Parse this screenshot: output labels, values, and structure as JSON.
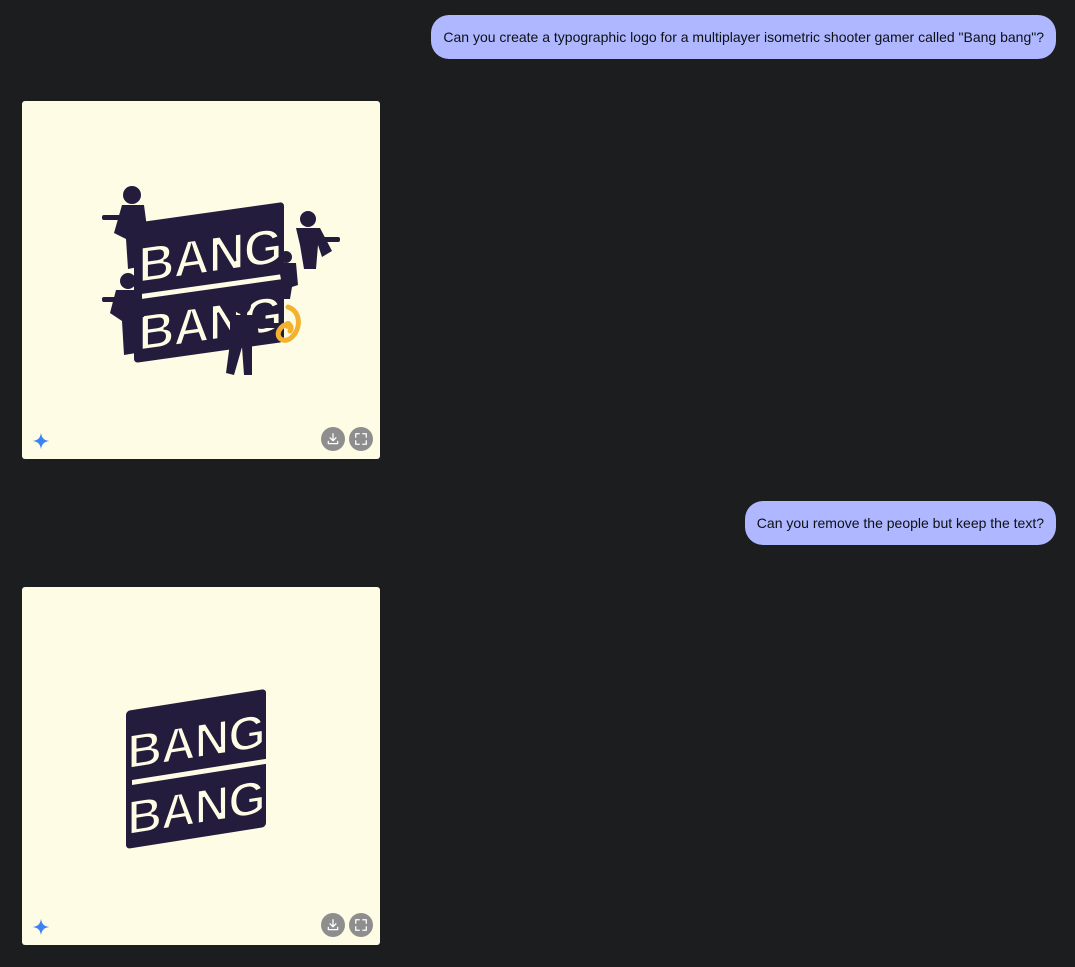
{
  "messages": [
    {
      "role": "user",
      "text": "Can you create a typographic logo for a multiplayer isometric shooter gamer called \"Bang bang\"?"
    },
    {
      "role": "assistant",
      "image": {
        "logo_word_top": "BANG",
        "logo_word_bottom": "BANG",
        "variant": "with-characters",
        "background": "#fefce5",
        "ink": "#231c3d",
        "accent": "#f3b12d"
      }
    },
    {
      "role": "user",
      "text": "Can you remove the people but keep the text?"
    },
    {
      "role": "assistant",
      "image": {
        "logo_word_top": "BANG",
        "logo_word_bottom": "BANG",
        "variant": "text-only",
        "background": "#fefce5",
        "ink": "#231c3d"
      }
    }
  ],
  "card_icons": {
    "badge": "sparkle-icon",
    "download": "download-icon",
    "fullscreen": "fullscreen-icon"
  },
  "colors": {
    "page_bg": "#1c1d1f",
    "user_bubble": "#aeb7ff",
    "sparkle": "#3b82f6",
    "action_button": "#8e8e8e"
  }
}
